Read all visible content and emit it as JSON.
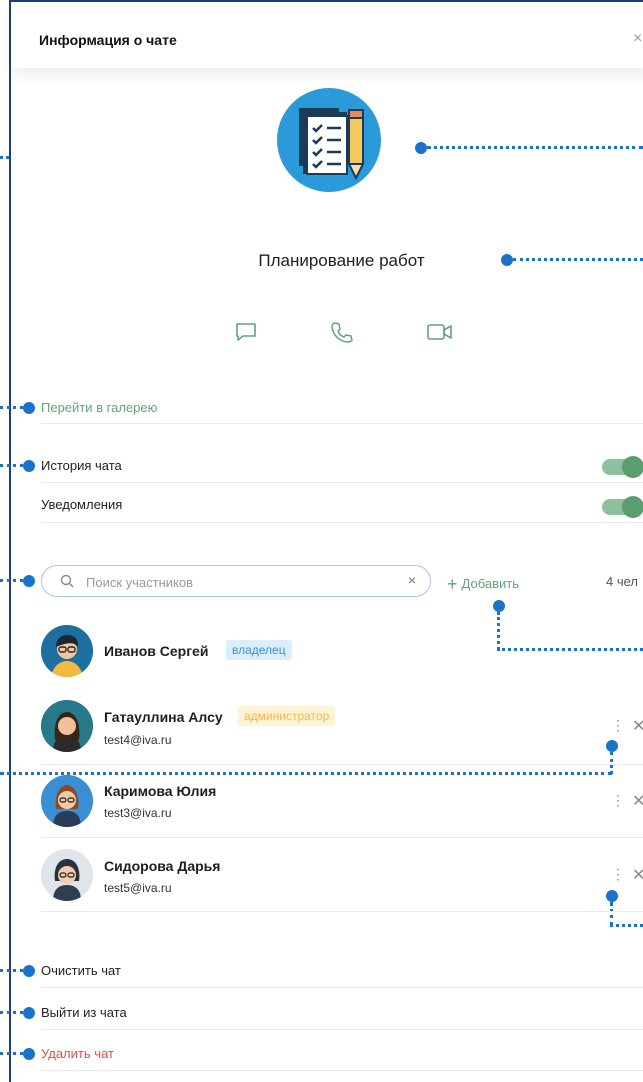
{
  "header": {
    "title": "Информация о чате",
    "close_label": "×"
  },
  "chat": {
    "name": "Планирование работ"
  },
  "actions": {
    "message_icon": "chat-bubble-icon",
    "call_icon": "phone-icon",
    "video_icon": "video-camera-icon"
  },
  "links": {
    "gallery": "Перейти в галерею",
    "clear": "Очистить чат",
    "leave": "Выйти из чата",
    "delete": "Удалить чат"
  },
  "settings": [
    {
      "label": "История чата",
      "enabled": true
    },
    {
      "label": "Уведомления",
      "enabled": true
    }
  ],
  "search": {
    "placeholder": "Поиск участников",
    "value": "",
    "clear_label": "×"
  },
  "add": {
    "label": "Добавить",
    "plus": "+"
  },
  "members_count": "4 чел",
  "members": [
    {
      "name": "Иванов Сергей",
      "badge": "владелец",
      "email": ""
    },
    {
      "name": "Гатауллина Алсу",
      "badge": "администратор",
      "email": "test4@iva.ru"
    },
    {
      "name": "Каримова Юлия",
      "badge": "",
      "email": "test3@iva.ru"
    },
    {
      "name": "Сидорова Дарья",
      "badge": "",
      "email": "test5@iva.ru"
    }
  ],
  "member_controls": {
    "more": "⋮",
    "remove": "✕"
  },
  "colors": {
    "accent_green": "#5fa57a",
    "danger_red": "#e14d4d",
    "annotation_blue": "#1a73c9",
    "owner_badge": "#3a8fd8",
    "admin_badge": "#f2b84a"
  }
}
